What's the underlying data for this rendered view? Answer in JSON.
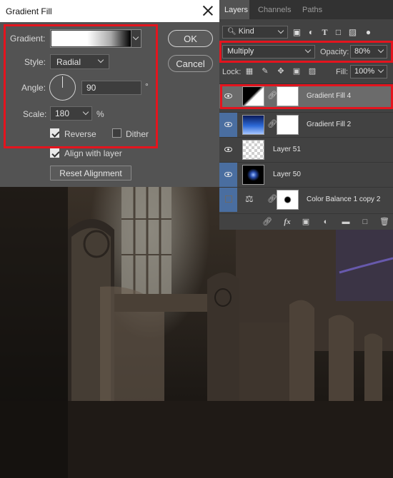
{
  "dialog": {
    "title": "Gradient Fill",
    "gradient_label": "Gradient:",
    "style_label": "Style:",
    "style_value": "Radial",
    "angle_label": "Angle:",
    "angle_value": "90",
    "angle_unit": "°",
    "scale_label": "Scale:",
    "scale_value": "180",
    "scale_unit": "%",
    "reverse_label": "Reverse",
    "reverse_checked": true,
    "dither_label": "Dither",
    "dither_checked": false,
    "align_label": "Align with layer",
    "align_checked": true,
    "reset_label": "Reset Alignment",
    "ok_label": "OK",
    "cancel_label": "Cancel",
    "highlight_color": "#e4141e"
  },
  "layers_panel": {
    "tabs": [
      "Layers",
      "Channels",
      "Paths"
    ],
    "active_tab": "Layers",
    "filter_label": "Kind",
    "blend_mode": "Multiply",
    "opacity_label": "Opacity:",
    "opacity_value": "80%",
    "lock_label": "Lock:",
    "fill_label": "Fill:",
    "fill_value": "100%",
    "layers": [
      {
        "name": "Gradient Fill 4",
        "visible": true,
        "selected": true
      },
      {
        "name": "Gradient Fill 2",
        "visible": true,
        "selected": false
      },
      {
        "name": "Layer 51",
        "visible": true,
        "selected": false
      },
      {
        "name": "Layer 50",
        "visible": true,
        "selected": false
      },
      {
        "name": "Color Balance 1 copy 2",
        "visible": false,
        "selected": false
      }
    ],
    "filter_icons": [
      "image-filter-icon",
      "adjustment-filter-icon",
      "type-filter-icon",
      "shape-filter-icon",
      "smart-object-filter-icon"
    ],
    "lock_icons": [
      "lock-transparent-icon",
      "lock-pixels-icon",
      "lock-position-icon",
      "lock-artboard-icon",
      "lock-all-icon"
    ],
    "bottom_icons": [
      "link-layers-icon",
      "fx-icon",
      "add-mask-icon",
      "new-adjustment-icon",
      "new-group-icon",
      "new-layer-icon",
      "delete-layer-icon"
    ],
    "accent_color": "#4a6ea0"
  }
}
